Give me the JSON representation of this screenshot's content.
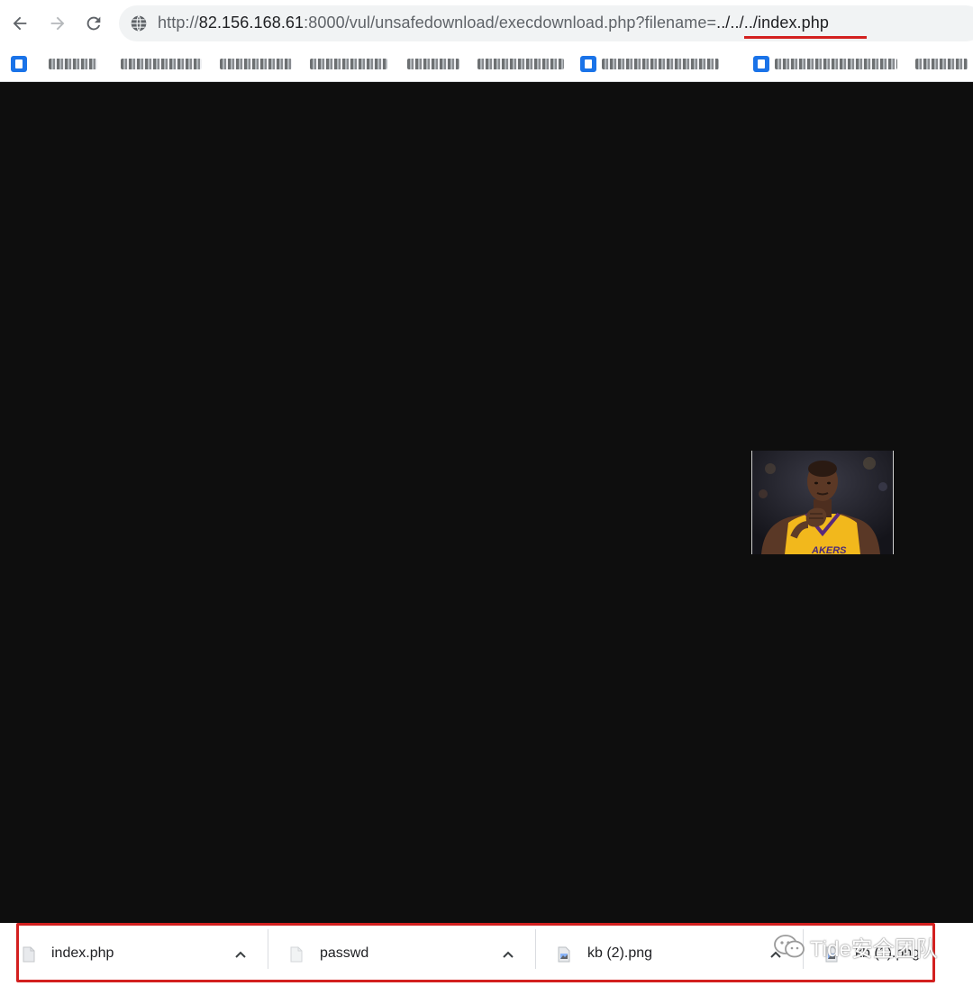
{
  "browser": {
    "url": {
      "scheme": "http://",
      "host": "82.156.168.61",
      "path": ":8000/vul/unsafedownload/execdownload.php?filename=",
      "highlighted": "../../../index.php"
    },
    "bookmarks_count": 9
  },
  "downloads": [
    {
      "name": "index.php",
      "type": "document"
    },
    {
      "name": "passwd",
      "type": "document"
    },
    {
      "name": "kb (2).png",
      "type": "image"
    },
    {
      "name": "kb (1).png",
      "type": "image"
    }
  ],
  "watermark": {
    "text": "Tide安全团队"
  },
  "colors": {
    "accent_red": "#d3201f",
    "page_bg": "#0e0e0e",
    "bookmark_icon": "#1a73e8"
  }
}
